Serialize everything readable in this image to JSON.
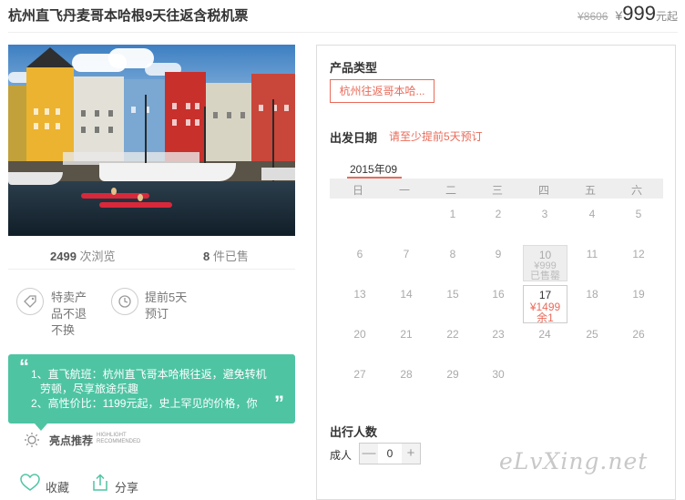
{
  "header": {
    "title": "杭州直飞丹麦哥本哈根9天往返含税机票",
    "old_price": "¥8606",
    "currency": "¥",
    "price": "999",
    "unit": "元起"
  },
  "stats": {
    "views_num": "2499",
    "views_label": "次浏览",
    "sold_num": "8",
    "sold_label": "件已售"
  },
  "features": [
    {
      "icon": "tag-icon",
      "lines": [
        "特卖产",
        "品不退",
        "不换"
      ]
    },
    {
      "icon": "clock-icon",
      "lines": [
        "提前5天",
        "预订"
      ]
    }
  ],
  "highlight": {
    "line1": "1、直飞航班：杭州直飞哥本哈根往返，避免转机",
    "line2": "劳顿，尽享旅途乐趣",
    "line3": "2、高性价比：1199元起，史上罕见的价格，你",
    "label_cn": "亮点推荐",
    "label_en1": "HIGHLIGHT",
    "label_en2": "RECOMMENDED"
  },
  "actions": {
    "favorite": "收藏",
    "share": "分享"
  },
  "booking": {
    "product_type_label": "产品类型",
    "product_option": "杭州往返哥本哈...",
    "date_label": "出发日期",
    "date_note": "请至少提前5天预订",
    "month": "2015年09",
    "weekdays": [
      "日",
      "一",
      "二",
      "三",
      "四",
      "五",
      "六"
    ],
    "days": [
      "1",
      "2",
      "3",
      "4",
      "5",
      "6",
      "7",
      "8",
      "9",
      "10",
      "11",
      "12",
      "13",
      "14",
      "15",
      "16",
      "17",
      "18",
      "19",
      "20",
      "21",
      "22",
      "23",
      "24",
      "25",
      "26",
      "27",
      "28",
      "29",
      "30"
    ],
    "day10_price": "¥999",
    "day10_status": "已售罄",
    "day17_price": "¥1499",
    "day17_remain": "余1",
    "travelers_label": "出行人数",
    "adult_label": "成人",
    "adult_count": "0",
    "minus": "—",
    "plus": "+"
  },
  "colors": {
    "accent": "#ea6b5a",
    "highlight_bg": "#4ec4a3"
  },
  "watermark": "eLvXing.net"
}
